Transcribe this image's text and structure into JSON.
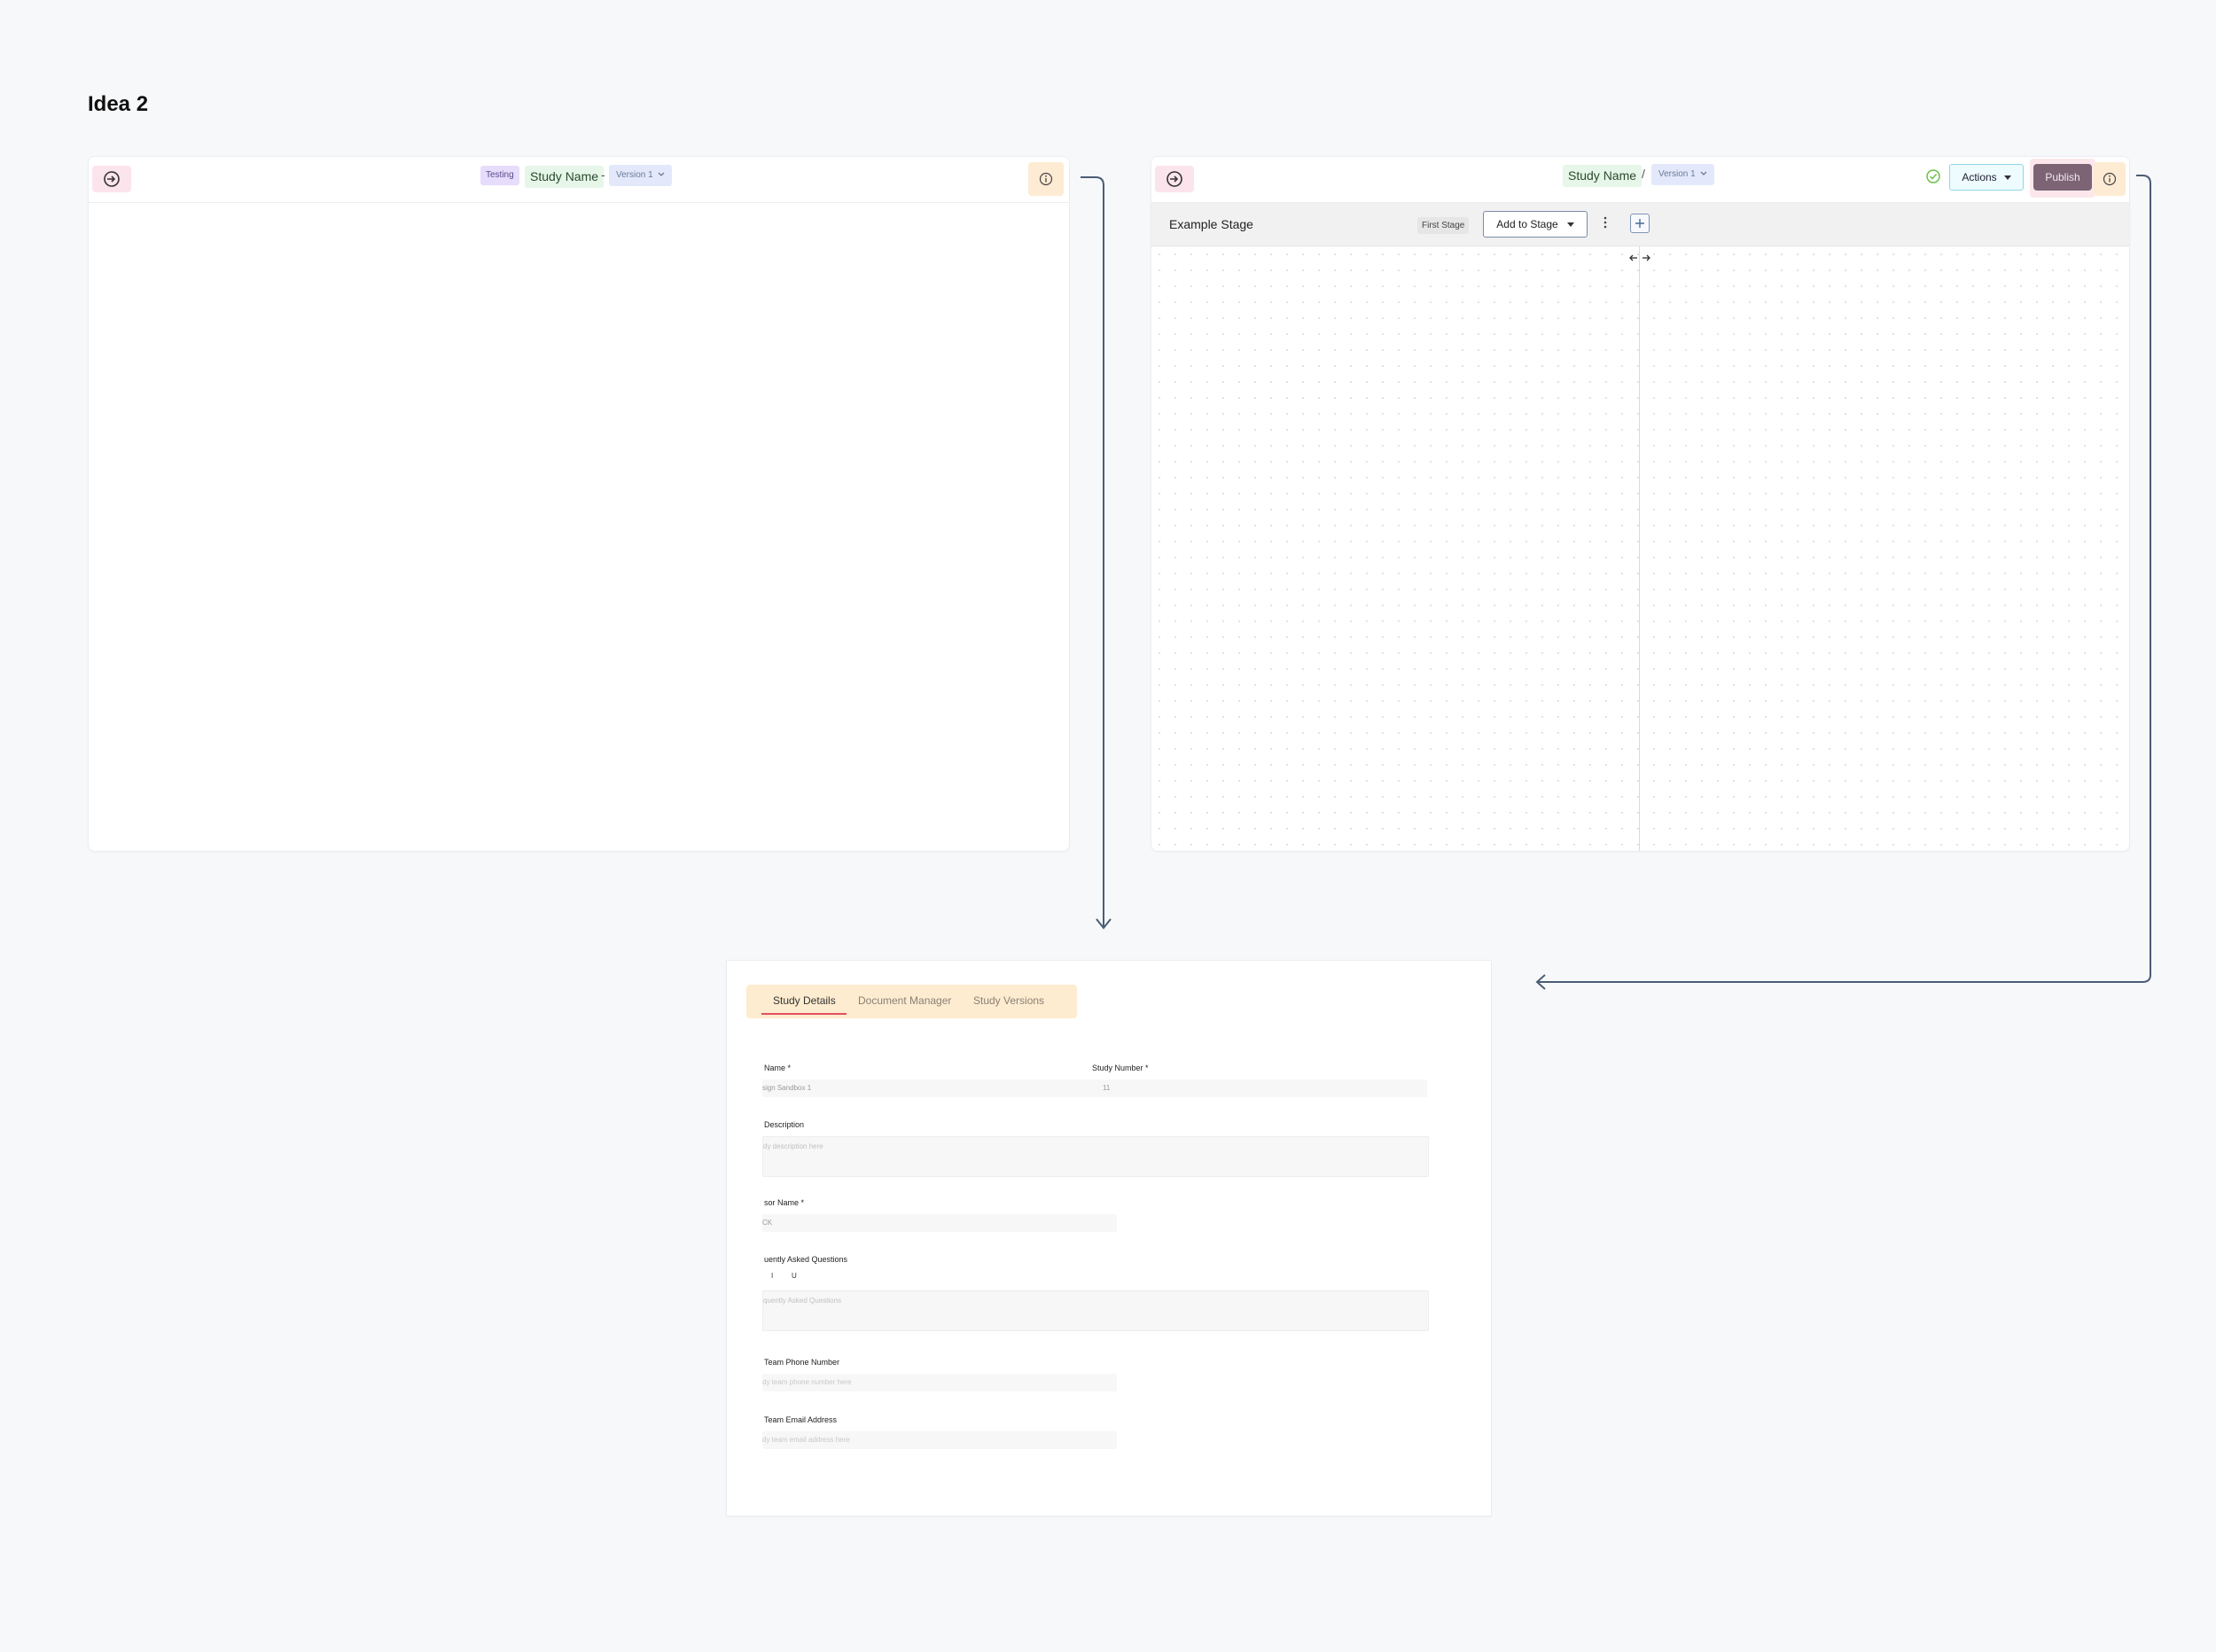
{
  "page": {
    "title": "Idea 2"
  },
  "frame1": {
    "badge": "Testing",
    "study_name": "Study Name",
    "separator": "-",
    "version": "Version 1"
  },
  "frame2": {
    "study_name": "Study Name",
    "separator": "/",
    "version": "Version 1",
    "actions_label": "Actions",
    "publish_label": "Publish",
    "stage_title": "Example Stage",
    "stage_badge": "First Stage",
    "add_to_stage_label": "Add to Stage"
  },
  "panel": {
    "tabs": [
      {
        "label": "Study Details",
        "active": true
      },
      {
        "label": "Document Manager",
        "active": false
      },
      {
        "label": "Study Versions",
        "active": false
      }
    ],
    "fields": {
      "study_name": {
        "label": "Name *",
        "value": "sign Sandbox 1"
      },
      "study_number": {
        "label": "Study Number *",
        "value": "11"
      },
      "description": {
        "label": "Description",
        "placeholder": "dy description here"
      },
      "sponsor_name": {
        "label": "sor Name *",
        "value": "CK"
      },
      "faq": {
        "label": "uently Asked Questions",
        "placeholder": "quently Asked Questions",
        "toolbar": [
          "I",
          "U"
        ]
      },
      "team_phone": {
        "label": "Team Phone Number",
        "placeholder": "dy team phone number here"
      },
      "team_email": {
        "label": "Team Email Address",
        "placeholder": "dy team email address here"
      }
    }
  },
  "colors": {
    "background": "#f7f8fa",
    "testing_badge": "#e6dcfb",
    "study_name_pill": "#e6f6e8",
    "version_pill": "#e3e9fb",
    "publish": "#7d6475",
    "tabs_bg": "#fdeccf",
    "tab_active_underline": "#e2525d",
    "connector": "#4a5d75"
  },
  "icons": [
    "sign-in-icon",
    "info-icon",
    "check-circle-icon",
    "caret-down-icon",
    "chevron-down-icon",
    "kebab-icon",
    "plus-icon",
    "resize-arrows-icon"
  ]
}
